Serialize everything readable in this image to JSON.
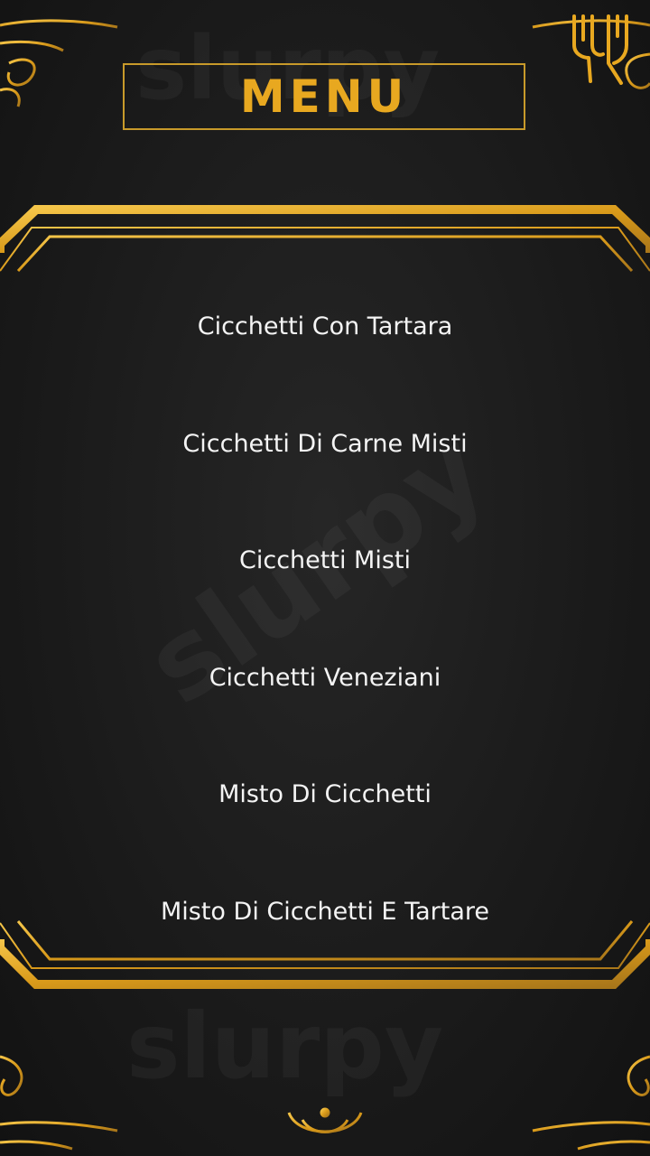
{
  "header": {
    "title": "MENU",
    "logo_icon": "fork-knife-icon"
  },
  "menu": {
    "items": [
      "Cicchetti Con Tartara",
      "Cicchetti Di Carne Misti",
      "Cicchetti Misti",
      "Cicchetti Veneziani",
      "Misto Di Cicchetti",
      "Misto Di Cicchetti E Tartare"
    ]
  },
  "watermark": "slurpy",
  "colors": {
    "gold": "#e8a820",
    "gold_dark": "#b9871f",
    "background": "#1b1b1b",
    "text": "#f4f4f4"
  }
}
